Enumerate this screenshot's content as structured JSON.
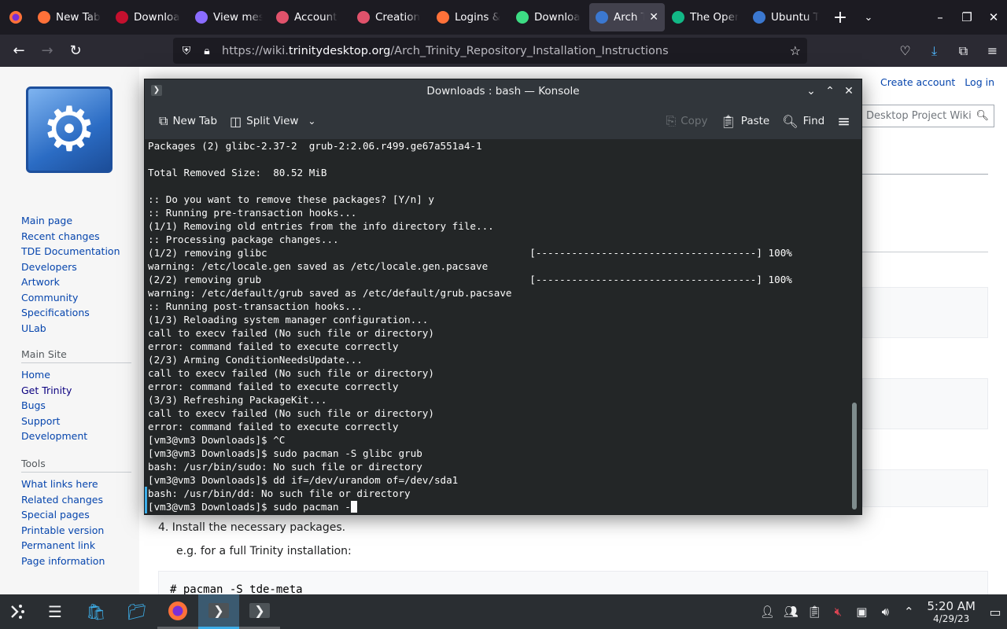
{
  "browser": {
    "tabs": [
      {
        "label": "New Tab",
        "icon": "firefox-icon",
        "color": "#ff7139",
        "active": false
      },
      {
        "label": "Downloa",
        "icon": "vivaldi-icon",
        "color": "#c4102e",
        "active": false
      },
      {
        "label": "View mes",
        "icon": "mail-icon",
        "color": "#8a6cff",
        "active": false
      },
      {
        "label": "Account",
        "icon": "infinity-icon",
        "color": "#e0526b",
        "active": false
      },
      {
        "label": "Creation",
        "icon": "infinity-icon",
        "color": "#e0526b",
        "active": false
      },
      {
        "label": "Logins &",
        "icon": "firefox-icon",
        "color": "#ff7139",
        "active": false
      },
      {
        "label": "Downloa",
        "icon": "android-studio-icon",
        "color": "#3ddc84",
        "active": false
      },
      {
        "label": "Arch Tr",
        "icon": "trinity-icon",
        "color": "#3b78d0",
        "active": true
      },
      {
        "label": "The Oper",
        "icon": "opera-icon",
        "color": "#12b886",
        "active": false
      },
      {
        "label": "Ubuntu T",
        "icon": "trinity-icon",
        "color": "#3b78d0",
        "active": false
      }
    ],
    "url_prefix": "https://wiki.",
    "url_domain": "trinitydesktop.org",
    "url_path": "/Arch_Trinity_Repository_Installation_Instructions"
  },
  "wiki": {
    "personal": {
      "create_account": "Create account",
      "log_in": "Log in"
    },
    "search_placeholder": "Desktop Project Wiki",
    "nav_links": [
      "Main page",
      "Recent changes",
      "TDE Documentation",
      "Developers",
      "Artwork",
      "Community",
      "Specifications",
      "ULab"
    ],
    "main_site": {
      "heading": "Main Site",
      "links": [
        "Home",
        "Get Trinity",
        "Bugs",
        "Support",
        "Development"
      ]
    },
    "tools": {
      "heading": "Tools",
      "links": [
        "What links here",
        "Related changes",
        "Special pages",
        "Printable version",
        "Permanent link",
        "Page information"
      ]
    },
    "step4": "4. Install the necessary packages.",
    "step4_eg": "e.g. for a full Trinity installation:",
    "code": "# pacman -S tde-meta"
  },
  "konsole": {
    "title": "Downloads : bash — Konsole",
    "toolbar": {
      "new_tab": "New Tab",
      "split_view": "Split View",
      "copy": "Copy",
      "paste": "Paste",
      "find": "Find"
    },
    "lines": [
      "Packages (2) glibc-2.37-2  grub-2:2.06.r499.ge67a551a4-1",
      "",
      "Total Removed Size:  80.52 MiB",
      "",
      ":: Do you want to remove these packages? [Y/n] y",
      ":: Running pre-transaction hooks...",
      "(1/1) Removing old entries from the info directory file...",
      ":: Processing package changes...",
      "(1/2) removing glibc                                            [-------------------------------------] 100%",
      "warning: /etc/locale.gen saved as /etc/locale.gen.pacsave",
      "(2/2) removing grub                                             [-------------------------------------] 100%",
      "warning: /etc/default/grub saved as /etc/default/grub.pacsave",
      ":: Running post-transaction hooks...",
      "(1/3) Reloading system manager configuration...",
      "call to execv failed (No such file or directory)",
      "error: command failed to execute correctly",
      "(2/3) Arming ConditionNeedsUpdate...",
      "call to execv failed (No such file or directory)",
      "error: command failed to execute correctly",
      "(3/3) Refreshing PackageKit...",
      "call to execv failed (No such file or directory)",
      "error: command failed to execute correctly",
      "[vm3@vm3 Downloads]$ ^C",
      "[vm3@vm3 Downloads]$ sudo pacman -S glibc grub",
      "bash: /usr/bin/sudo: No such file or directory",
      "[vm3@vm3 Downloads]$ dd if=/dev/urandom of=/dev/sda1",
      "bash: /usr/bin/dd: No such file or directory"
    ],
    "prompt_line": "[vm3@vm3 Downloads]$ sudo pacman -"
  },
  "taskbar": {
    "time": "5:20 AM",
    "date": "4/29/23"
  }
}
